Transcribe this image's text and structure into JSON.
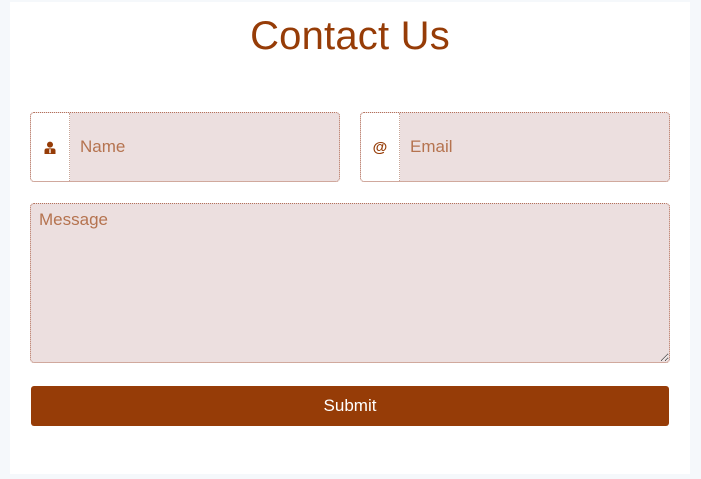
{
  "form": {
    "title": "Contact Us",
    "name": {
      "placeholder": "Name",
      "value": "",
      "icon": "user-icon"
    },
    "email": {
      "placeholder": "Email",
      "value": "",
      "icon": "at-sign-icon",
      "icon_glyph": "@"
    },
    "message": {
      "placeholder": "Message",
      "value": ""
    },
    "submit_label": "Submit"
  },
  "colors": {
    "accent": "#963c07",
    "field_background": "#ecdfdf",
    "placeholder": "#b5734f",
    "page_background": "#f5f8fb",
    "card_background": "#ffffff"
  }
}
